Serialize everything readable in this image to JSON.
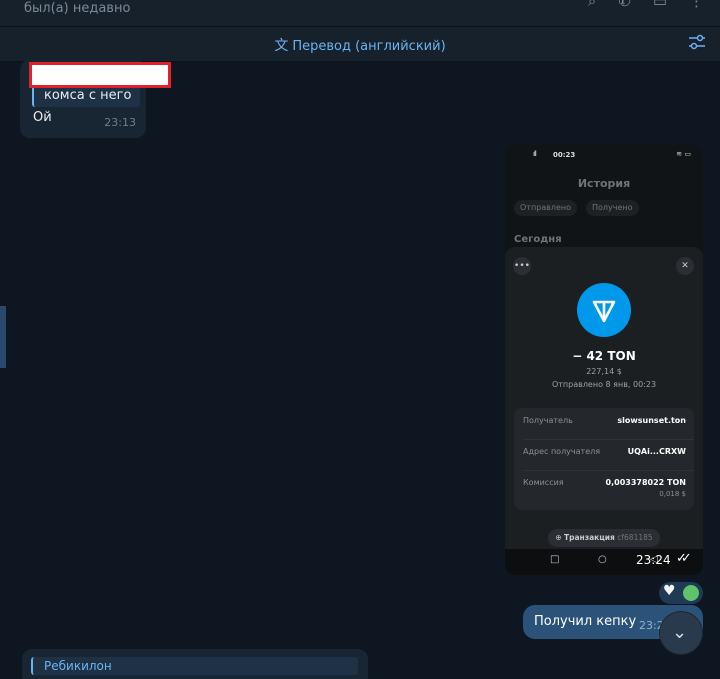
{
  "header": {
    "status": "был(а) недавно",
    "icons": [
      "search-icon",
      "phone-icon",
      "layout-icon",
      "more-icon"
    ]
  },
  "translate_bar": {
    "label": "Перевод (английский)",
    "icon": "translate-icon",
    "settings_icon": "settings-sliders-icon"
  },
  "messages": {
    "incoming": {
      "reply_text": "комса с него",
      "text": "Ой",
      "time": "23:13"
    },
    "photo": {
      "phone_time": "00:23",
      "title": "История",
      "chips": [
        "Отправлено",
        "Получено"
      ],
      "section": "Сегодня",
      "amount": "− 42 TON",
      "usd": "227,14 $",
      "sent_date": "Отправлено 8 янв, 00:23",
      "details": [
        {
          "label": "Получатель",
          "value": "slowsunset.ton",
          "sub": ""
        },
        {
          "label": "Адрес получателя",
          "value": "UQAi...CRXW",
          "sub": ""
        },
        {
          "label": "Комиссия",
          "value": "0,003378022 TON",
          "sub": "0,018 $"
        }
      ],
      "tx_label": "Транзакция",
      "tx_hash": "cf681185",
      "time": "23:24"
    },
    "reactions": [
      "heart-icon",
      "green-circle"
    ],
    "outgoing": {
      "text": "Получил кепку",
      "time": "23:2"
    },
    "bottom": {
      "reply_text": "Ребикилон"
    }
  },
  "colors": {
    "background": "#0e1621",
    "incoming_bubble": "#182533",
    "outgoing_bubble": "#2b5278",
    "accent": "#6ab3f3",
    "ton_blue": "#0098ea",
    "redaction": "#e0202a"
  }
}
